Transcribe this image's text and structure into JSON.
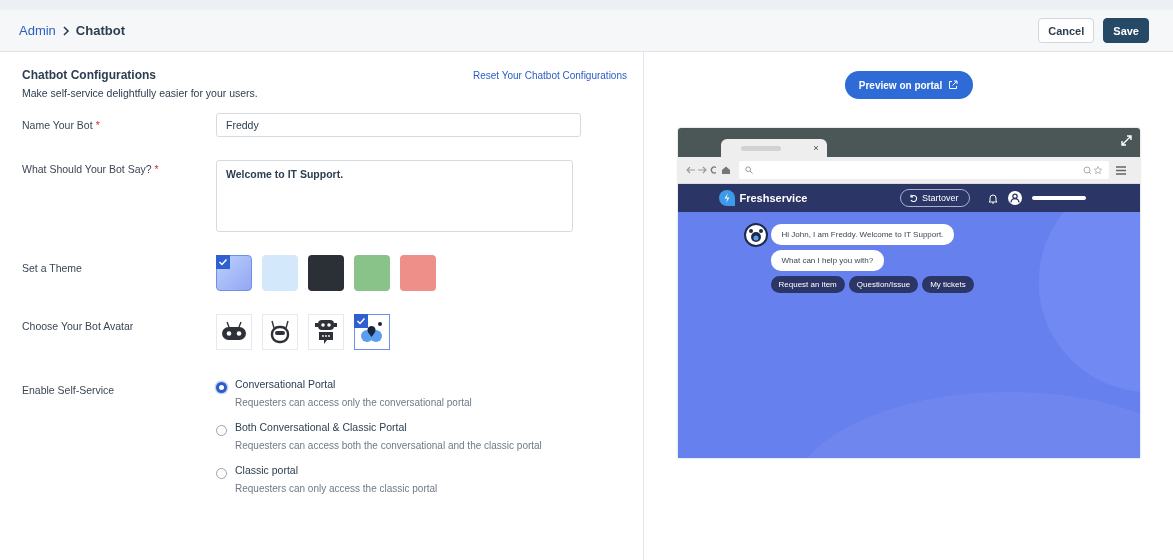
{
  "breadcrumb": {
    "parent": "Admin",
    "current": "Chatbot"
  },
  "header_buttons": [
    {
      "label": "Cancel",
      "kind": "secondary"
    },
    {
      "label": "Save",
      "kind": "primary"
    }
  ],
  "config": {
    "title": "Chatbot Configurations",
    "subtitle": "Make self-service delightfully easier for your users.",
    "reset_link": "Reset Your Chatbot Configurations"
  },
  "fields": [
    {
      "label": "Name Your Bot",
      "required_mark": "*",
      "kind": "input",
      "value": "Freddy"
    },
    {
      "label": "What Should Your Bot Say?",
      "required_mark": "*",
      "kind": "textarea",
      "value": "Welcome to IT Support."
    }
  ],
  "theme": {
    "label": "Set a Theme",
    "swatches": [
      {
        "color": "#95a6f4",
        "selected": true
      },
      {
        "color": "#d3e8fb",
        "selected": false
      },
      {
        "color": "#2b2f36",
        "selected": false
      },
      {
        "color": "#89c389",
        "selected": false
      },
      {
        "color": "#ef8f89",
        "selected": false
      }
    ]
  },
  "avatar": {
    "label": "Choose Your Bot Avatar",
    "options": [
      {
        "kind": "robot-wide",
        "selected": false
      },
      {
        "kind": "robot-antenna",
        "selected": false
      },
      {
        "kind": "robot-chat",
        "selected": false
      },
      {
        "kind": "blob",
        "selected": true
      }
    ]
  },
  "self_service": {
    "label": "Enable Self-Service",
    "options": [
      {
        "title": "Conversational Portal",
        "description": "Requesters can access only the conversational portal",
        "selected": true
      },
      {
        "title": "Both Conversational & Classic Portal",
        "description": "Requesters can access both the conversational and the classic portal",
        "selected": false
      },
      {
        "title": "Classic portal",
        "description": "Requesters can only access the classic portal",
        "selected": false
      }
    ]
  },
  "preview": {
    "button": "Preview on portal",
    "brand": "Freshservice",
    "startover": "Startover",
    "messages": [
      "Hi John, I am Freddy. Welcome to IT Support.",
      "What can I help you with?"
    ],
    "quick_replies": [
      "Request an item",
      "Question/Issue",
      "My tickets"
    ]
  }
}
